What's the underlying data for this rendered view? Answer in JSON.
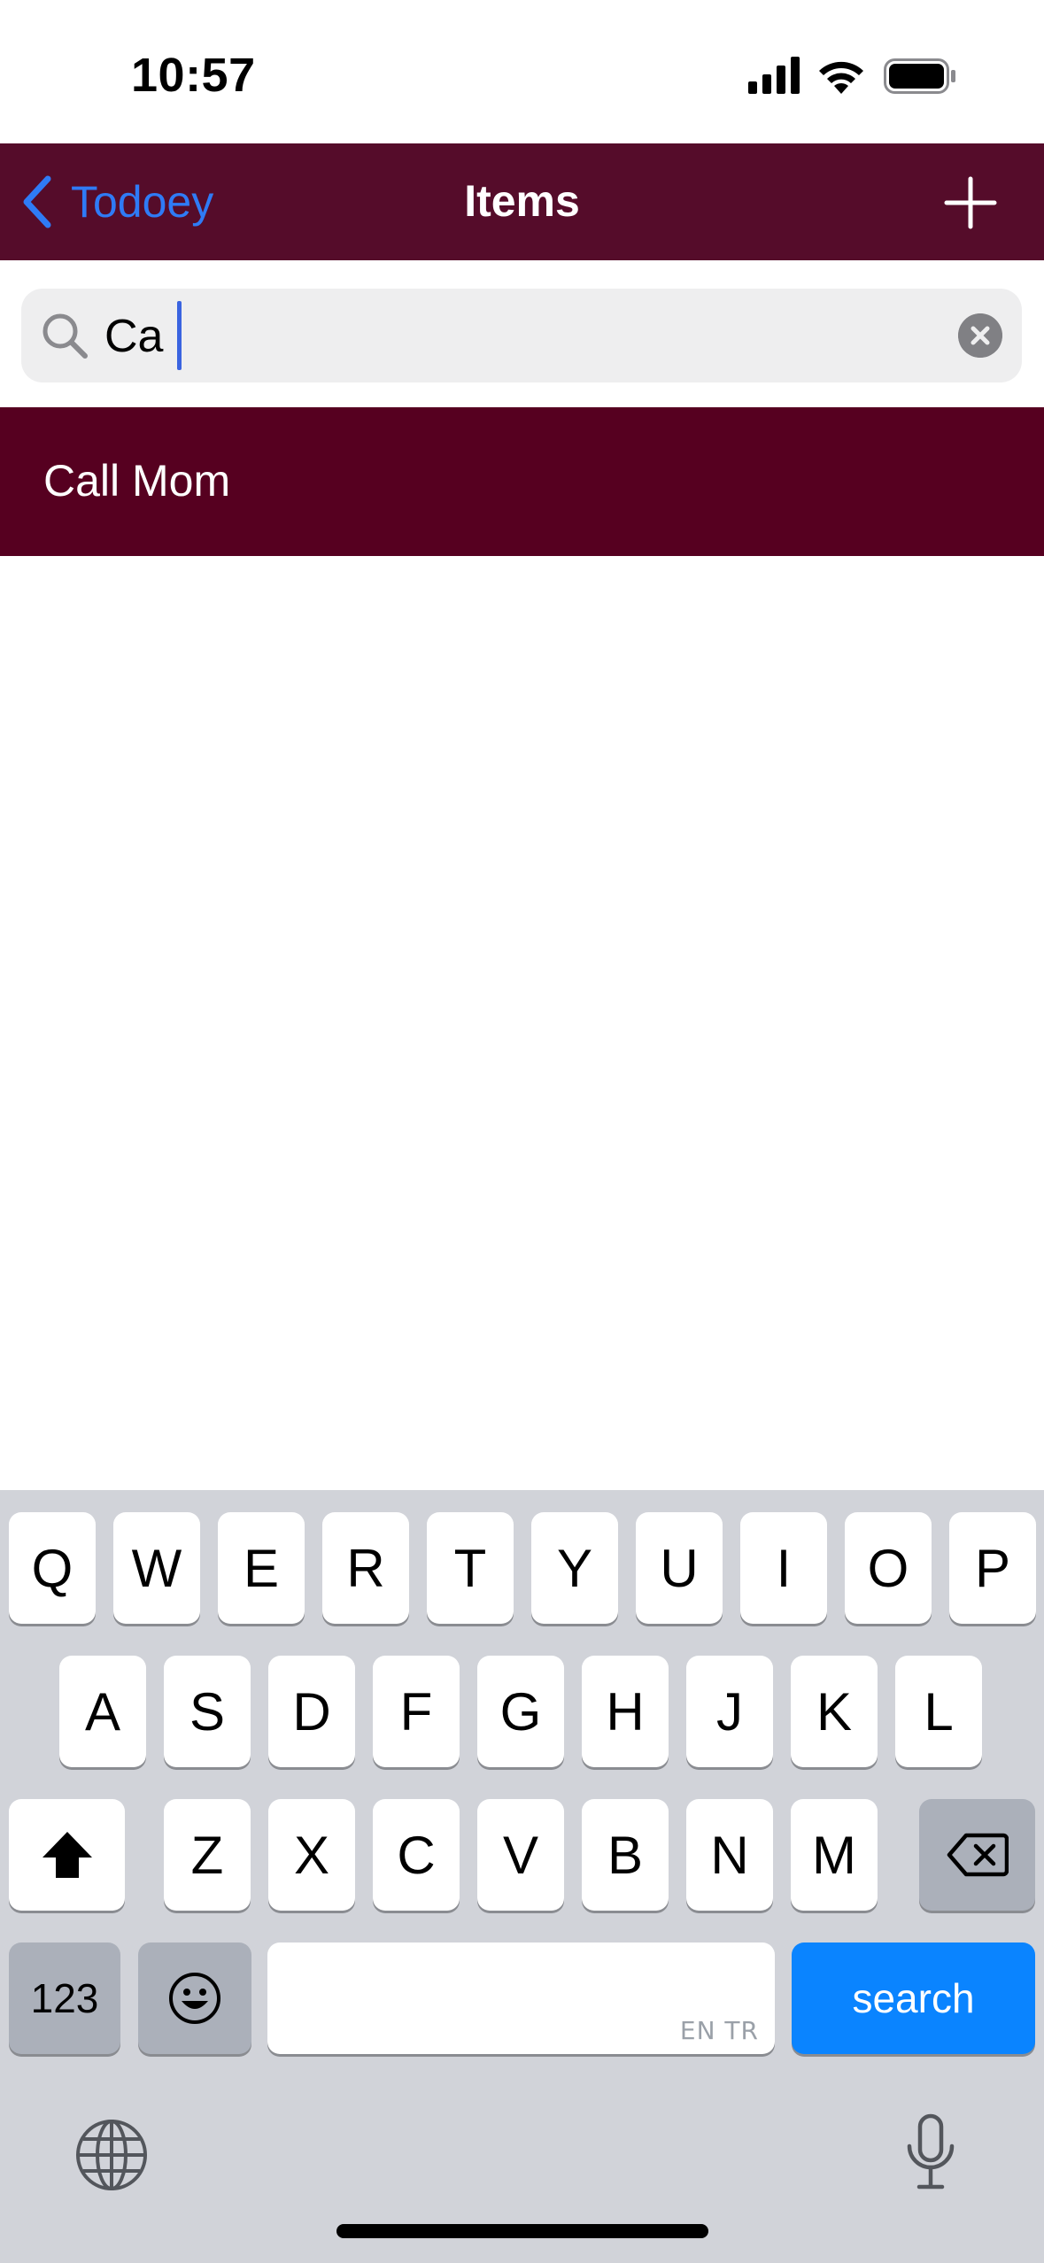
{
  "status_bar": {
    "time": "10:57"
  },
  "nav": {
    "back_label": "Todoey",
    "title": "Items",
    "bar_color": "#550c2a",
    "accent_color": "#2f7bf6"
  },
  "search": {
    "value": "Ca"
  },
  "list": {
    "items": [
      {
        "label": "Call Mom",
        "color": "#560020"
      }
    ]
  },
  "keyboard": {
    "row1": [
      "Q",
      "W",
      "E",
      "R",
      "T",
      "Y",
      "U",
      "I",
      "O",
      "P"
    ],
    "row2": [
      "A",
      "S",
      "D",
      "F",
      "G",
      "H",
      "J",
      "K",
      "L"
    ],
    "row3": [
      "Z",
      "X",
      "C",
      "V",
      "B",
      "N",
      "M"
    ],
    "numbers_label": "123",
    "space_hint": "EN TR",
    "action_label": "search",
    "action_color": "#0a84ff",
    "icons": {
      "shift": "shift-icon",
      "delete": "delete-icon",
      "emoji": "emoji-icon",
      "globe": "globe-icon",
      "mic": "microphone-icon"
    }
  }
}
